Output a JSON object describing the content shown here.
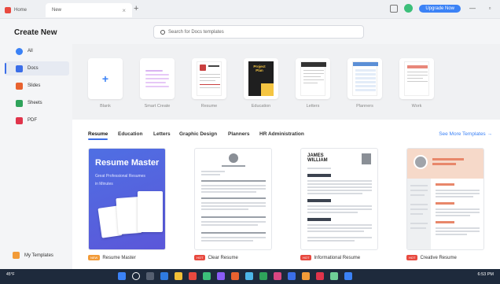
{
  "titlebar": {
    "tabs": [
      {
        "label": "Home"
      },
      {
        "label": "New"
      }
    ],
    "upgrade_label": "Upgrade Now"
  },
  "sidebar": {
    "title": "Create New",
    "items": [
      {
        "label": "All",
        "color": "#3b82f6"
      },
      {
        "label": "Docs",
        "color": "#3b6ee8",
        "active": true
      },
      {
        "label": "Slides",
        "color": "#e8622f"
      },
      {
        "label": "Sheets",
        "color": "#2fa35b"
      },
      {
        "label": "PDF",
        "color": "#e0344b"
      }
    ],
    "my_templates": "My Templates"
  },
  "search": {
    "placeholder": "Search for Docs templates"
  },
  "categories": [
    {
      "label": "Blank"
    },
    {
      "label": "Smart Create"
    },
    {
      "label": "Resume"
    },
    {
      "label": "Education"
    },
    {
      "label": "Letters"
    },
    {
      "label": "Planners"
    },
    {
      "label": "Work"
    }
  ],
  "education_card_text": "Project Plan",
  "filters": [
    {
      "label": "Resume",
      "active": true
    },
    {
      "label": "Education"
    },
    {
      "label": "Letters"
    },
    {
      "label": "Graphic Design"
    },
    {
      "label": "Planners"
    },
    {
      "label": "HR Administration"
    }
  ],
  "see_more": "See More Templates →",
  "templates": [
    {
      "caption": "Resume Master",
      "badge": "NEW",
      "badge_color": "#f29b38"
    },
    {
      "caption": "Clear Resume",
      "badge": "HOT",
      "badge_color": "#e8493f"
    },
    {
      "caption": "Informational Resume",
      "badge": "HOT",
      "badge_color": "#e8493f"
    },
    {
      "caption": "Creative Resume",
      "badge": "HOT",
      "badge_color": "#e8493f"
    }
  ],
  "resume_master": {
    "title": "Resume Master",
    "subtitle": "Great Professional Resumes",
    "subtitle2": "in Minutes"
  },
  "informational_resume_name": "JAMES\nWILLIAM",
  "taskbar": {
    "weather": "45°F",
    "time": "6:53 PM"
  }
}
